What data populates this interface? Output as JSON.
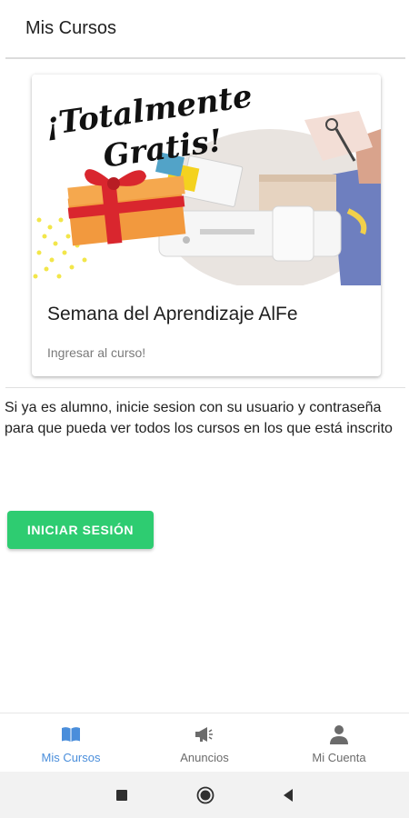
{
  "app_bar": {
    "title": "Mis Cursos"
  },
  "course_card": {
    "banner_text_line1": "¡Totalmente",
    "banner_text_line2": "Gratis!",
    "title": "Semana del Aprendizaje AlFe",
    "action_label": "Ingresar al curso!"
  },
  "info": {
    "message": "Si ya es alumno, inicie sesion con su usuario y contraseña para que pueda ver todos los cursos en los que está inscrito"
  },
  "login_button": {
    "label": "INICIAR SESIÓN"
  },
  "bottom_nav": {
    "items": [
      {
        "label": "Mis Cursos",
        "icon": "book-icon",
        "active": true
      },
      {
        "label": "Anuncios",
        "icon": "megaphone-icon",
        "active": false
      },
      {
        "label": "Mi Cuenta",
        "icon": "person-icon",
        "active": false
      }
    ]
  },
  "system_nav": {
    "icons": [
      "recents-square-icon",
      "home-circle-icon",
      "back-triangle-icon"
    ]
  },
  "colors": {
    "accent_green": "#2ecc71",
    "active_nav_blue": "#4a8edb",
    "inactive_nav_gray": "#6b6b6b"
  }
}
